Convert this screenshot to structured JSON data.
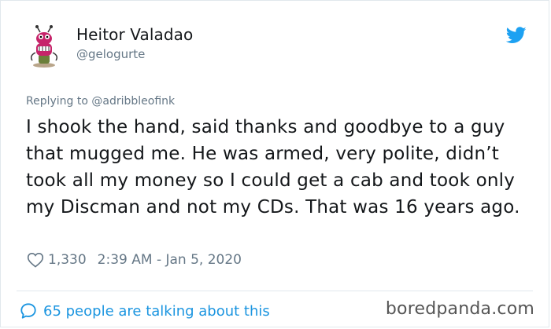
{
  "author": {
    "name": "Heitor Valadao",
    "handle": "@gelogurte",
    "avatar_icon": "cartoon-avatar"
  },
  "brand_icon": "twitter-bird-icon",
  "colors": {
    "twitter_blue": "#1da1f2",
    "link_blue": "#1b95e0",
    "muted": "#657786",
    "text": "#14171a"
  },
  "tweet": {
    "replying_to": "Replying to @adribbleofink",
    "text": "I shook the hand, said thanks and goodbye to a guy that mugged me. He was armed, very polite, didn’t took all my money so I could get a cab and took only my Discman and not my CDs. That was 16 years ago.",
    "likes": "1,330",
    "timestamp": "2:39 AM - Jan 5, 2020"
  },
  "footer": {
    "talking": "65 people are talking about this"
  },
  "watermark": "boredpanda.com"
}
